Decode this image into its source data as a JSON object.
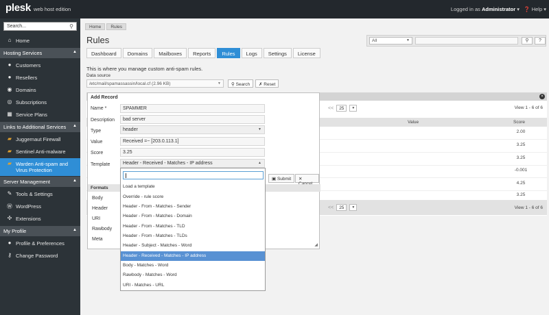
{
  "header": {
    "logo": "plesk",
    "edition": "web host edition",
    "logged_in_label": "Logged in as",
    "user": "Administrator",
    "help": "Help"
  },
  "sidebar": {
    "search_placeholder": "Search...",
    "home": "Home",
    "sections": [
      {
        "label": "Hosting Services",
        "items": [
          "Customers",
          "Resellers",
          "Domains",
          "Subscriptions",
          "Service Plans"
        ]
      },
      {
        "label": "Links to Additional Services",
        "items": [
          "Juggernaut Firewall",
          "Sentinel Anti-malware",
          "Warden Anti-spam and Virus Protection"
        ]
      },
      {
        "label": "Server Management",
        "items": [
          "Tools & Settings",
          "WordPress",
          "Extensions"
        ]
      },
      {
        "label": "My Profile",
        "items": [
          "Profile & Preferences",
          "Change Password"
        ]
      }
    ]
  },
  "breadcrumb": [
    "Home",
    "Rules"
  ],
  "page_title": "Rules",
  "global_search": {
    "scope": "All"
  },
  "tabs": [
    "Dashboard",
    "Domains",
    "Mailboxes",
    "Reports",
    "Rules",
    "Logs",
    "Settings",
    "License"
  ],
  "active_tab": "Rules",
  "description": "This is where you manage custom anti-spam rules.",
  "data_source": {
    "label": "Data source",
    "value": "/etc/mail/spamassassin/local.cf (2.96 KB)",
    "search_button": "Search",
    "reset_button": "Reset"
  },
  "grid": {
    "per_page": "25",
    "view_count": "View 1 - 6 of 6",
    "columns": {
      "value": "Value",
      "score": "Score"
    },
    "scores": [
      "2.00",
      "3.25",
      "3.25",
      "-0.001",
      "4.25",
      "3.25"
    ]
  },
  "dialog": {
    "title": "Add Record",
    "fields": {
      "name": {
        "label": "Name *",
        "value": "SPAMMER"
      },
      "description": {
        "label": "Description",
        "value": "bad server"
      },
      "type": {
        "label": "Type",
        "value": "header"
      },
      "value": {
        "label": "Value",
        "value": "Received =~ [203.0.113.1]"
      },
      "score": {
        "label": "Score",
        "value": "3.25"
      },
      "template": {
        "label": "Template",
        "value": "Header - Received - Matches - IP address"
      }
    },
    "submit_button": "Submit",
    "cancel_button": "Cancel",
    "formats_label": "Formats",
    "formats": [
      "Body",
      "Header",
      "URI",
      "Rawbody",
      "Meta"
    ]
  },
  "template_dropdown": {
    "options": [
      "Load a template",
      "Override - rule score",
      "Header - From - Matches - Sender",
      "Header - From - Matches - Domain",
      "Header - From - Matches - TLD",
      "Header - From - Matches - TLDs",
      "Header - Subject - Matches - Word",
      "Header - Received - Matches - IP address",
      "Body - Matches - Word",
      "Rawbody - Matches - Word",
      "URI - Matches - URL"
    ],
    "highlighted_index": 7
  },
  "colors": {
    "accent": "#2f8ed6",
    "topbar": "#23282d",
    "sidebar": "#2c3338",
    "highlight": "#5891d3"
  }
}
